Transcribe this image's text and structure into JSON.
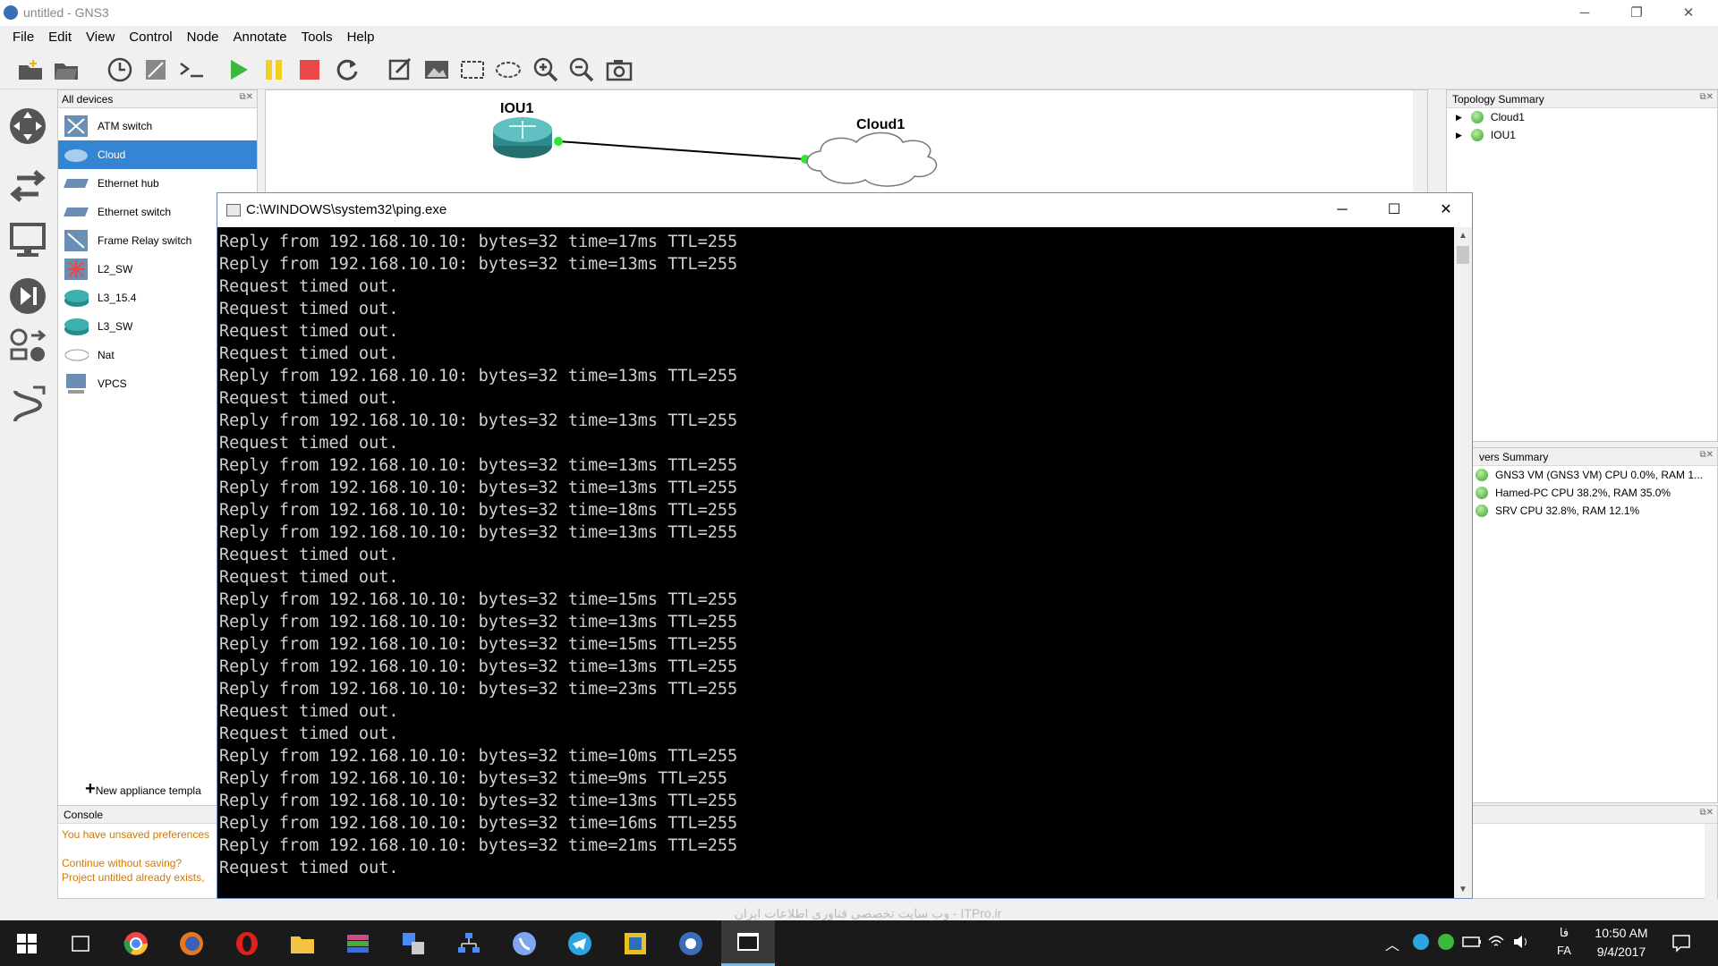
{
  "window": {
    "title": "untitled - GNS3",
    "minimize": "─",
    "restore": "❐",
    "close": "✕"
  },
  "menu": [
    "File",
    "Edit",
    "View",
    "Control",
    "Node",
    "Annotate",
    "Tools",
    "Help"
  ],
  "devices_panel": {
    "header": "All devices",
    "items": [
      {
        "label": "ATM switch",
        "icon": "atm-switch-icon"
      },
      {
        "label": "Cloud",
        "icon": "cloud-icon",
        "selected": true
      },
      {
        "label": "Ethernet hub",
        "icon": "ethernet-hub-icon"
      },
      {
        "label": "Ethernet switch",
        "icon": "ethernet-switch-icon"
      },
      {
        "label": "Frame Relay switch",
        "icon": "frame-relay-switch-icon"
      },
      {
        "label": "L2_SW",
        "icon": "l2-switch-icon"
      },
      {
        "label": "L3_15.4",
        "icon": "router-icon"
      },
      {
        "label": "L3_SW",
        "icon": "router-icon"
      },
      {
        "label": "Nat",
        "icon": "nat-icon"
      },
      {
        "label": "VPCS",
        "icon": "vpcs-icon"
      }
    ],
    "new_template": "New appliance templa"
  },
  "canvas": {
    "node_router": "IOU1",
    "node_cloud": "Cloud1"
  },
  "topology_summary": {
    "header": "Topology Summary",
    "items": [
      "Cloud1",
      "IOU1"
    ]
  },
  "servers_summary": {
    "header": "vers Summary",
    "items": [
      "GNS3 VM (GNS3 VM) CPU 0.0%, RAM 1...",
      "Hamed-PC CPU 38.2%, RAM 35.0%",
      "SRV CPU 32.8%, RAM 12.1%"
    ]
  },
  "console": {
    "header": "Console",
    "line1": "You have unsaved preferences",
    "line2": "Continue without saving?",
    "line3": "Project untitled already exists,"
  },
  "terminal": {
    "title": "C:\\WINDOWS\\system32\\ping.exe",
    "lines": [
      "Reply from 192.168.10.10: bytes=32 time=17ms TTL=255",
      "Reply from 192.168.10.10: bytes=32 time=13ms TTL=255",
      "Request timed out.",
      "Request timed out.",
      "Request timed out.",
      "Request timed out.",
      "Reply from 192.168.10.10: bytes=32 time=13ms TTL=255",
      "Request timed out.",
      "Reply from 192.168.10.10: bytes=32 time=13ms TTL=255",
      "Request timed out.",
      "Reply from 192.168.10.10: bytes=32 time=13ms TTL=255",
      "Reply from 192.168.10.10: bytes=32 time=13ms TTL=255",
      "Reply from 192.168.10.10: bytes=32 time=18ms TTL=255",
      "Reply from 192.168.10.10: bytes=32 time=13ms TTL=255",
      "Request timed out.",
      "Request timed out.",
      "Reply from 192.168.10.10: bytes=32 time=15ms TTL=255",
      "Reply from 192.168.10.10: bytes=32 time=13ms TTL=255",
      "Reply from 192.168.10.10: bytes=32 time=15ms TTL=255",
      "Reply from 192.168.10.10: bytes=32 time=13ms TTL=255",
      "Reply from 192.168.10.10: bytes=32 time=23ms TTL=255",
      "Request timed out.",
      "Request timed out.",
      "Reply from 192.168.10.10: bytes=32 time=10ms TTL=255",
      "Reply from 192.168.10.10: bytes=32 time=9ms TTL=255",
      "Reply from 192.168.10.10: bytes=32 time=13ms TTL=255",
      "Reply from 192.168.10.10: bytes=32 time=16ms TTL=255",
      "Reply from 192.168.10.10: bytes=32 time=21ms TTL=255",
      "Request timed out."
    ]
  },
  "watermark": "وب سایت تخصصی فناوری اطلاعات ایران - ITPro.ir",
  "taskbar": {
    "lang_top": "فا",
    "lang": "FA",
    "time": "10:50 AM",
    "date": "9/4/2017"
  },
  "colors": {
    "selected": "#3585d5",
    "console_warning": "#d07a00",
    "status_green": "#3aa02c"
  }
}
